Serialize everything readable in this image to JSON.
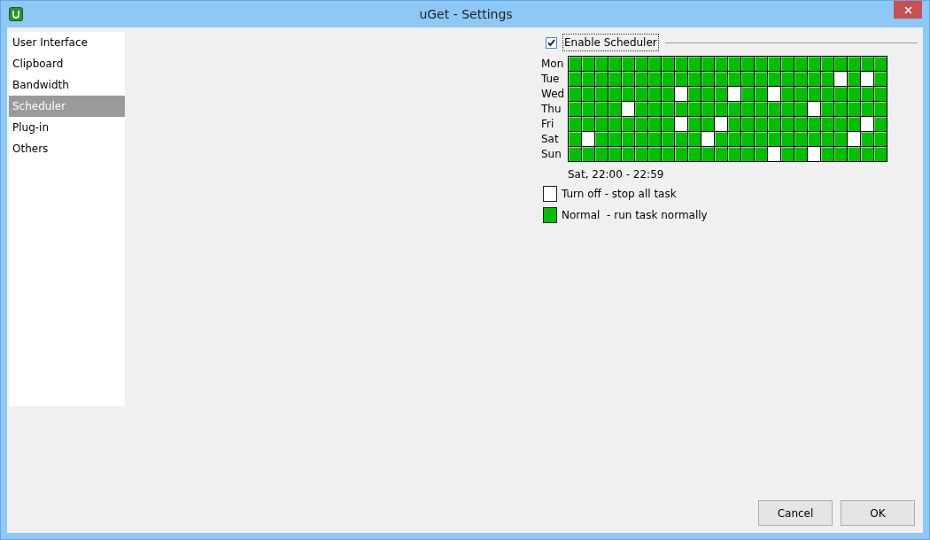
{
  "window": {
    "title": "uGet - Settings"
  },
  "sidebar": {
    "items": [
      {
        "label": "User Interface",
        "selected": false
      },
      {
        "label": "Clipboard",
        "selected": false
      },
      {
        "label": "Bandwidth",
        "selected": false
      },
      {
        "label": "Scheduler",
        "selected": true
      },
      {
        "label": "Plug-in",
        "selected": false
      },
      {
        "label": "Others",
        "selected": false
      }
    ]
  },
  "scheduler": {
    "enable": {
      "label": "Enable Scheduler",
      "checked": true
    },
    "days": [
      {
        "label": "Mon",
        "slots": [
          true,
          true,
          true,
          true,
          true,
          true,
          true,
          true,
          true,
          true,
          true,
          true,
          true,
          true,
          true,
          true,
          true,
          true,
          true,
          true,
          true,
          true,
          true,
          true
        ]
      },
      {
        "label": "Tue",
        "slots": [
          true,
          true,
          true,
          true,
          true,
          true,
          true,
          true,
          true,
          true,
          true,
          true,
          true,
          true,
          true,
          true,
          true,
          true,
          true,
          true,
          false,
          true,
          false,
          true
        ]
      },
      {
        "label": "Wed",
        "slots": [
          true,
          true,
          true,
          true,
          true,
          true,
          true,
          true,
          false,
          true,
          true,
          true,
          false,
          true,
          true,
          false,
          true,
          true,
          true,
          true,
          true,
          true,
          true,
          true
        ]
      },
      {
        "label": "Thu",
        "slots": [
          true,
          true,
          true,
          true,
          false,
          true,
          true,
          true,
          true,
          true,
          true,
          true,
          true,
          true,
          true,
          true,
          true,
          true,
          false,
          true,
          true,
          true,
          true,
          true
        ]
      },
      {
        "label": "Fri",
        "slots": [
          true,
          true,
          true,
          true,
          true,
          true,
          true,
          true,
          false,
          true,
          true,
          false,
          true,
          true,
          true,
          true,
          true,
          true,
          true,
          true,
          true,
          true,
          false,
          true
        ]
      },
      {
        "label": "Sat",
        "slots": [
          true,
          false,
          true,
          true,
          true,
          true,
          true,
          true,
          true,
          true,
          false,
          true,
          true,
          true,
          true,
          true,
          true,
          true,
          true,
          true,
          true,
          false,
          true,
          true
        ]
      },
      {
        "label": "Sun",
        "slots": [
          true,
          true,
          true,
          true,
          true,
          true,
          true,
          true,
          true,
          true,
          true,
          true,
          true,
          true,
          true,
          false,
          true,
          true,
          false,
          true,
          true,
          true,
          true,
          true
        ]
      }
    ],
    "time_label": "Sat, 22:00 - 22:59",
    "legend": [
      {
        "kind": "off",
        "label": "Turn off - stop all task"
      },
      {
        "kind": "normal",
        "label": "Normal  - run task normally"
      }
    ]
  },
  "buttons": [
    {
      "label": "Cancel"
    },
    {
      "label": "OK"
    }
  ]
}
